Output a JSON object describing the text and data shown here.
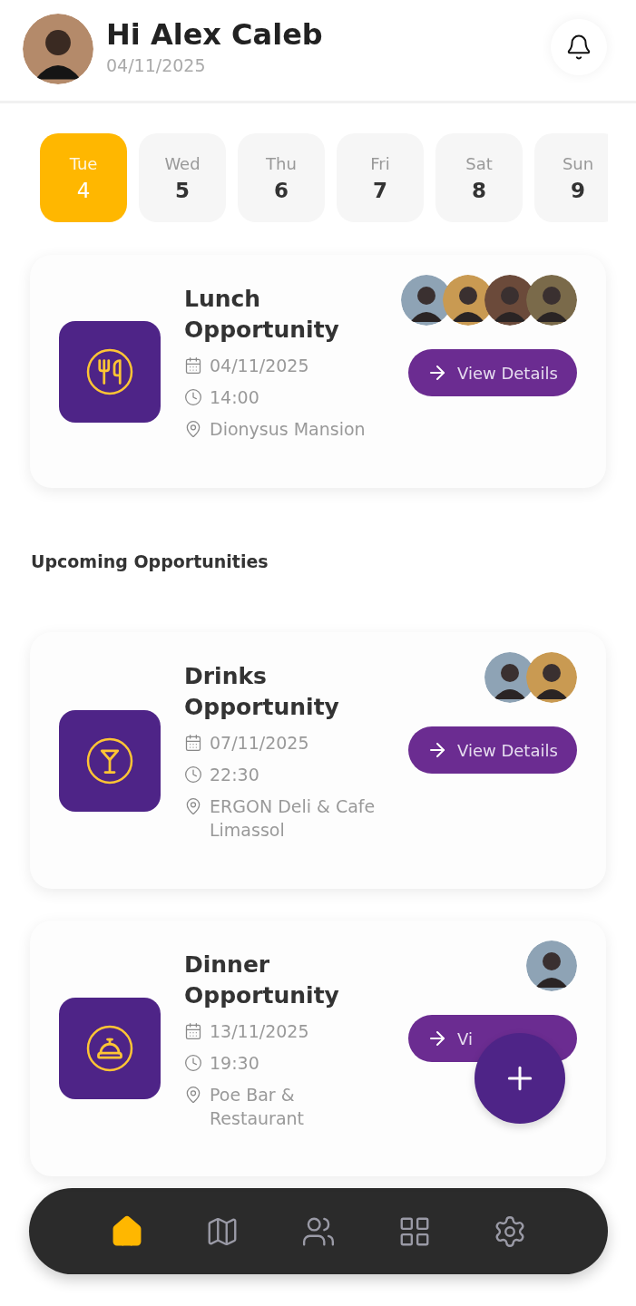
{
  "header": {
    "greeting": "Hi Alex Caleb",
    "date": "04/11/2025"
  },
  "days": [
    {
      "weekday": "Tue",
      "day": "4",
      "selected": true
    },
    {
      "weekday": "Wed",
      "day": "5",
      "selected": false
    },
    {
      "weekday": "Thu",
      "day": "6",
      "selected": false
    },
    {
      "weekday": "Fri",
      "day": "7",
      "selected": false
    },
    {
      "weekday": "Sat",
      "day": "8",
      "selected": false
    },
    {
      "weekday": "Sun",
      "day": "9",
      "selected": false
    }
  ],
  "featured": {
    "kind": "lunch",
    "title": "Lunch Opportunity",
    "date": "04/11/2025",
    "time": "14:00",
    "place": "Dionysus Mansion",
    "attendees": [
      {
        "kind": "person"
      },
      {
        "kind": "person"
      },
      {
        "kind": "person"
      },
      {
        "kind": "person"
      }
    ],
    "button": "View Details"
  },
  "section_title": "Upcoming Opportunities",
  "upcoming": [
    {
      "kind": "drinks",
      "title": "Drinks Opportunity",
      "date": "07/11/2025",
      "time": "22:30",
      "place": "ERGON Deli & Cafe Limassol",
      "attendees": [
        {
          "kind": "person"
        },
        {
          "kind": "person"
        }
      ],
      "button": "View Details"
    },
    {
      "kind": "dinner",
      "title": "Dinner Opportunity",
      "date": "13/11/2025",
      "time": "19:30",
      "place": "Poe Bar & Restaurant",
      "attendees": [
        {
          "kind": "person"
        }
      ],
      "button": "Vi"
    }
  ],
  "nav": [
    {
      "kind": "home",
      "selected": true
    },
    {
      "kind": "map",
      "selected": false
    },
    {
      "kind": "people",
      "selected": false
    },
    {
      "kind": "grid",
      "selected": false
    },
    {
      "kind": "settings",
      "selected": false
    }
  ]
}
